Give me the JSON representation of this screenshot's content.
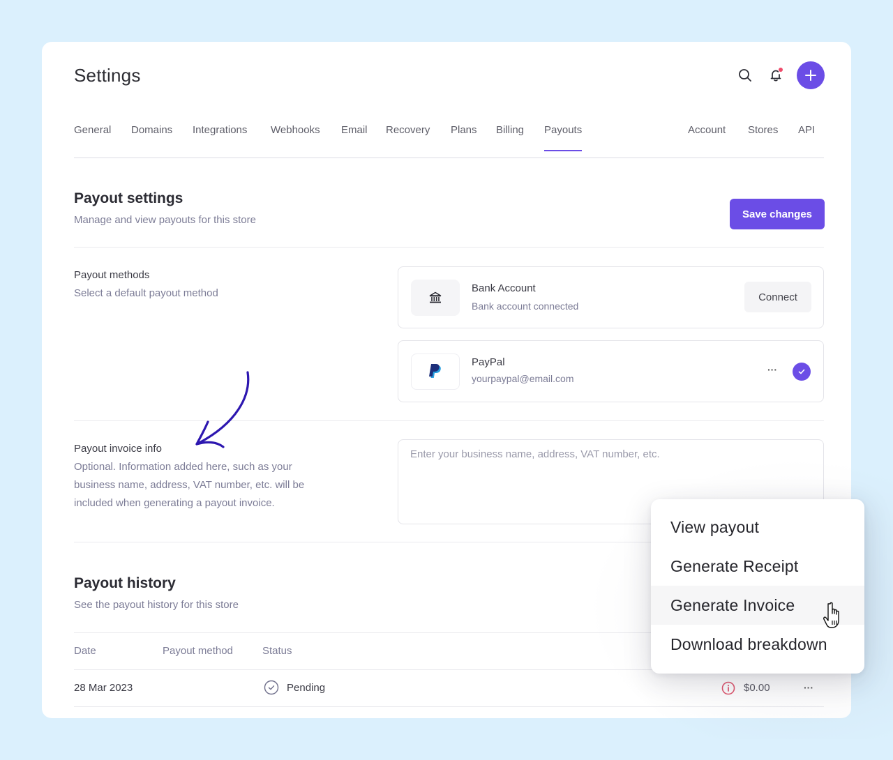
{
  "header": {
    "title": "Settings",
    "icons": {
      "search": "search-icon",
      "notifications": "bell-icon",
      "add": "plus-icon"
    },
    "add_label": "+"
  },
  "tabs": {
    "left": [
      {
        "label": "General"
      },
      {
        "label": "Domains"
      },
      {
        "label": "Integrations"
      },
      {
        "label": "Webhooks"
      },
      {
        "label": "Email"
      },
      {
        "label": "Recovery"
      },
      {
        "label": "Plans"
      },
      {
        "label": "Billing"
      },
      {
        "label": "Payouts",
        "active": true
      }
    ],
    "right": [
      {
        "label": "Account"
      },
      {
        "label": "Stores"
      },
      {
        "label": "API"
      }
    ]
  },
  "payout_settings": {
    "title": "Payout settings",
    "subtitle": "Manage and view payouts for this store",
    "save_label": "Save changes"
  },
  "payout_methods": {
    "label": "Payout methods",
    "description": "Select a default payout method",
    "methods": [
      {
        "name": "Bank Account",
        "detail": "Bank account connected",
        "icon": "bank-icon",
        "action_label": "Connect"
      },
      {
        "name": "PayPal",
        "detail": "yourpaypal@email.com",
        "icon": "paypal-logo-icon",
        "more_label": "···",
        "selected": true
      }
    ]
  },
  "invoice_info": {
    "label": "Payout invoice info",
    "description": "Optional. Information added here, such as your business name, address, VAT number, etc. will be included when generating a payout invoice.",
    "placeholder": "Enter your business name, address, VAT number, etc.",
    "value": ""
  },
  "payout_history": {
    "title": "Payout history",
    "subtitle": "See the payout history for this store",
    "columns": [
      "Date",
      "Payout method",
      "Status"
    ],
    "rows": [
      {
        "date": "28 Mar 2023",
        "method": "",
        "status": "Pending",
        "amount": "$0.00",
        "more_label": "···"
      }
    ]
  },
  "context_menu": {
    "items": [
      {
        "label": "View payout"
      },
      {
        "label": "Generate Receipt"
      },
      {
        "label": "Generate Invoice",
        "hovered": true
      },
      {
        "label": "Download breakdown"
      }
    ]
  },
  "colors": {
    "accent": "#6b4de6",
    "background": "#dbf0fd",
    "notification_dot": "#ef4a6a",
    "warning_icon": "#e0566e",
    "annotation_arrow": "#2d17b0"
  }
}
